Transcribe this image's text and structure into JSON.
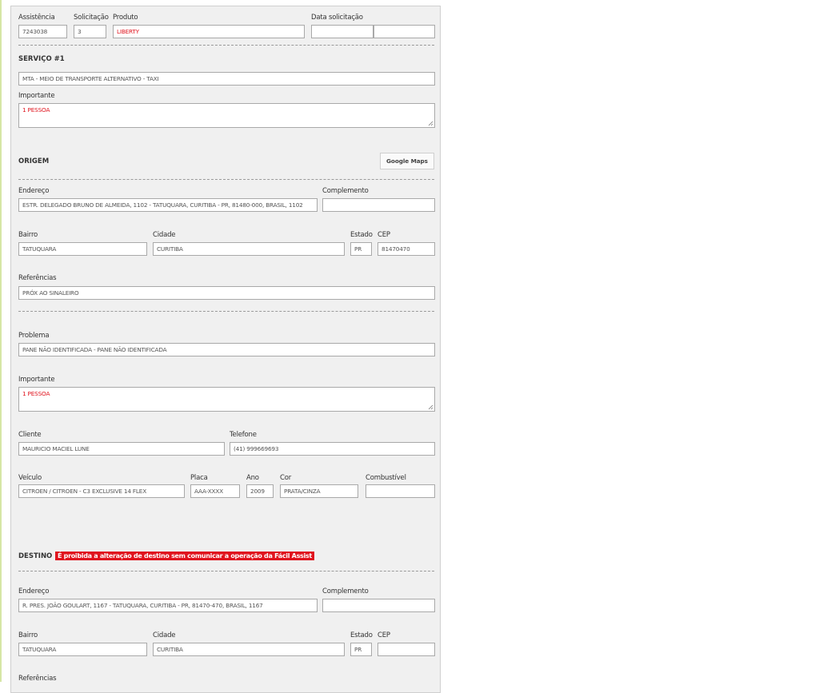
{
  "header": {
    "assistencia_label": "Assistência",
    "assistencia_value": "7243038",
    "solicitacao_label": "Solicitação",
    "solicitacao_value": "3",
    "produto_label": "Produto",
    "produto_value": "LIBERTY",
    "data_label": "Data solicitação",
    "data_value_1": "",
    "data_value_2": ""
  },
  "servico": {
    "title": "SERVIÇO #1",
    "tipo_value": "MTA - MEIO DE TRANSPORTE ALTERNATIVO - TAXI",
    "importante_label": "Importante",
    "importante_value": "1 PESSOA"
  },
  "origem": {
    "title": "ORIGEM",
    "maps_button": "Google Maps",
    "endereco_label": "Endereço",
    "endereco_value": "ESTR. DELEGADO BRUNO DE ALMEIDA, 1102 - TATUQUARA, CURITIBA - PR, 81480-000, BRASIL, 1102",
    "complemento_label": "Complemento",
    "complemento_value": "",
    "bairro_label": "Bairro",
    "bairro_value": "TATUQUARA",
    "cidade_label": "Cidade",
    "cidade_value": "CURITIBA",
    "estado_label": "Estado",
    "estado_value": "PR",
    "cep_label": "CEP",
    "cep_value": "81470470",
    "referencias_label": "Referências",
    "referencias_value": "PRÓX AO SINALEIRO"
  },
  "problema": {
    "problema_label": "Problema",
    "problema_value": "PANE NÃO IDENTIFICADA - PANE NÃO IDENTIFICADA",
    "importante_label": "Importante",
    "importante_value": "1 PESSOA"
  },
  "cliente": {
    "cliente_label": "Cliente",
    "cliente_value": "MAURICIO MACIEL LUNE",
    "telefone_label": "Telefone",
    "telefone_value": "(41) 999669693"
  },
  "veiculo": {
    "veiculo_label": "Veículo",
    "veiculo_value": "CITROEN / CITROEN - C3 EXCLUSIVE 14 FLEX",
    "placa_label": "Placa",
    "placa_value": "AAA-XXXX",
    "ano_label": "Ano",
    "ano_value": "2009",
    "cor_label": "Cor",
    "cor_value": "PRATA/CINZA",
    "combustivel_label": "Combustível",
    "combustivel_value": ""
  },
  "destino": {
    "title": "DESTINO",
    "warning": "É proibida a alteração de destino sem comunicar a operação da Fácil Assist",
    "endereco_label": "Endereço",
    "endereco_value": "R. PRES. JOÃO GOULART, 1167 - TATUQUARA, CURITIBA - PR, 81470-470, BRASIL, 1167",
    "complemento_label": "Complemento",
    "complemento_value": "",
    "bairro_label": "Bairro",
    "bairro_value": "TATUQUARA",
    "cidade_label": "Cidade",
    "cidade_value": "CURITIBA",
    "estado_label": "Estado",
    "estado_value": "PR",
    "cep_label": "CEP",
    "cep_value": "",
    "referencias_label": "Referências"
  },
  "colors": {
    "accent_red": "#e0141e",
    "panel_bg": "#f0f0f0",
    "border": "#a9a9a9"
  }
}
